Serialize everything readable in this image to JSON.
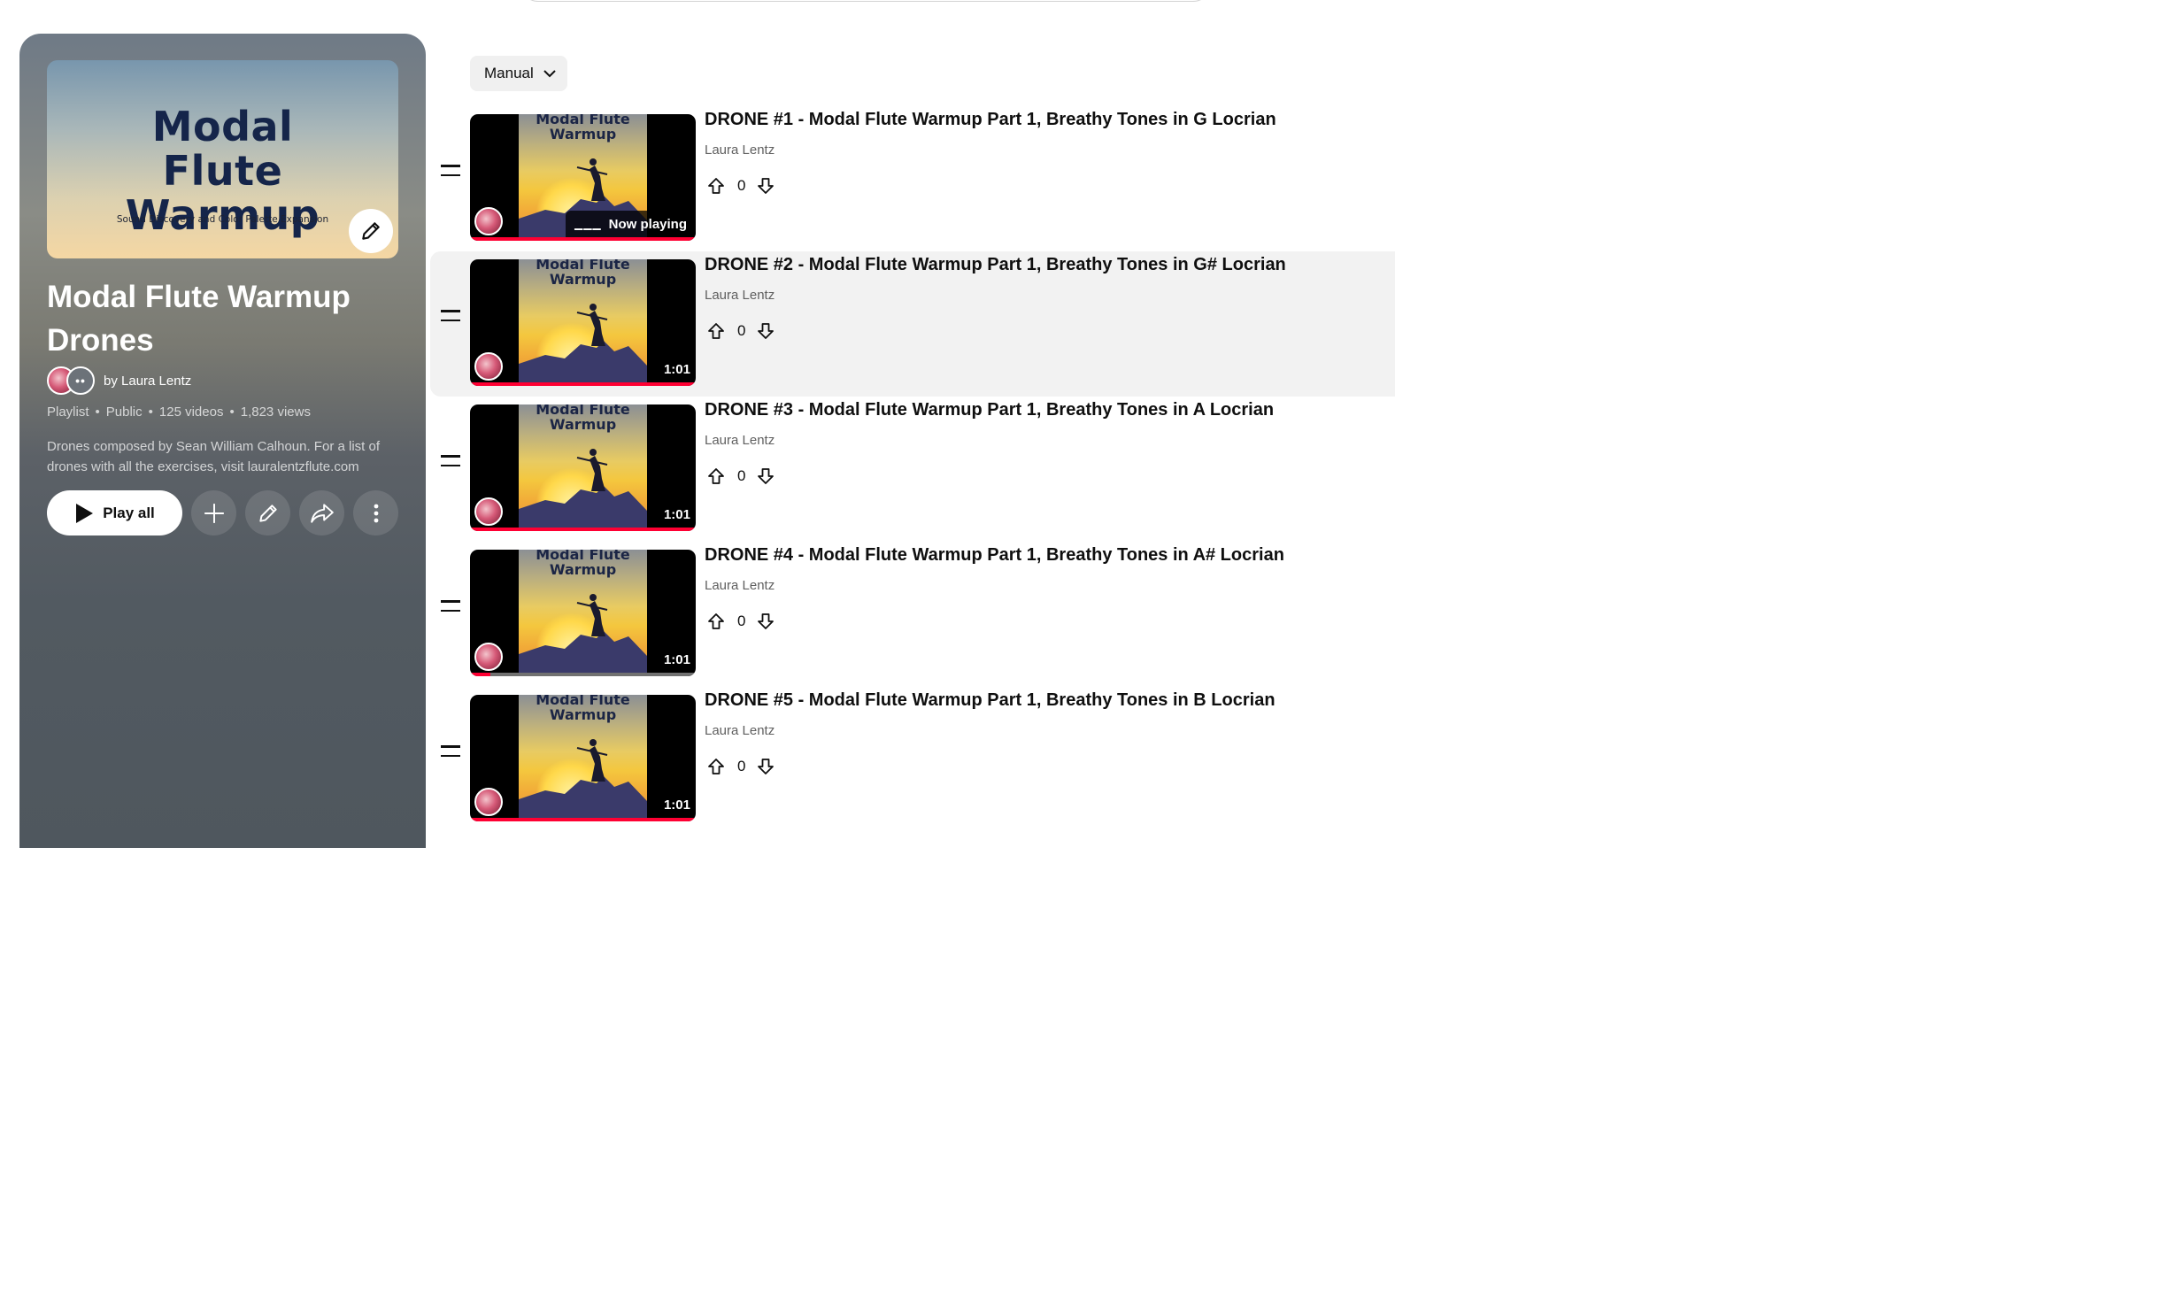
{
  "playlist": {
    "cover_title": "Modal Flute Warmup",
    "cover_subtitle": "Sound Discovery and Color Palette Expansion",
    "title": "Modal Flute Warmup Drones",
    "owner": "by Laura Lentz",
    "avatar_more": "••",
    "meta": {
      "type": "Playlist",
      "privacy": "Public",
      "videos": "125 videos",
      "views": "1,823 views"
    },
    "description": "Drones composed by Sean William Calhoun. For a list of drones with all the exercises, visit lauralentzflute.com",
    "play_all_label": "Play all"
  },
  "sort": {
    "label": "Manual"
  },
  "videos": [
    {
      "title": "DRONE #1 - Modal Flute Warmup Part 1, Breathy Tones in G Locrian",
      "channel": "Laura Lentz",
      "likes": "0",
      "duration": "",
      "now_playing": "Now playing",
      "thumb_title": "Modal Flute Warmup",
      "progress": 1.0
    },
    {
      "title": "DRONE #2 - Modal Flute Warmup Part 1, Breathy Tones in G# Locrian",
      "channel": "Laura Lentz",
      "likes": "0",
      "duration": "1:01",
      "now_playing": "",
      "thumb_title": "Modal Flute Warmup",
      "progress": 1.0
    },
    {
      "title": "DRONE #3 - Modal Flute Warmup Part 1, Breathy Tones in A Locrian",
      "channel": "Laura Lentz",
      "likes": "0",
      "duration": "1:01",
      "now_playing": "",
      "thumb_title": "Modal Flute Warmup",
      "progress": 1.0
    },
    {
      "title": "DRONE #4 - Modal Flute Warmup Part 1, Breathy Tones in A# Locrian",
      "channel": "Laura Lentz",
      "likes": "0",
      "duration": "1:01",
      "now_playing": "",
      "thumb_title": "Modal Flute Warmup",
      "progress": 0.09
    },
    {
      "title": "DRONE #5 - Modal Flute Warmup Part 1, Breathy Tones in B Locrian",
      "channel": "Laura Lentz",
      "likes": "0",
      "duration": "1:01",
      "now_playing": "",
      "thumb_title": "Modal Flute Warmup",
      "progress": 1.0
    }
  ],
  "colors": {
    "progress": "#ff0033",
    "hover_row": "#f2f2f2"
  }
}
